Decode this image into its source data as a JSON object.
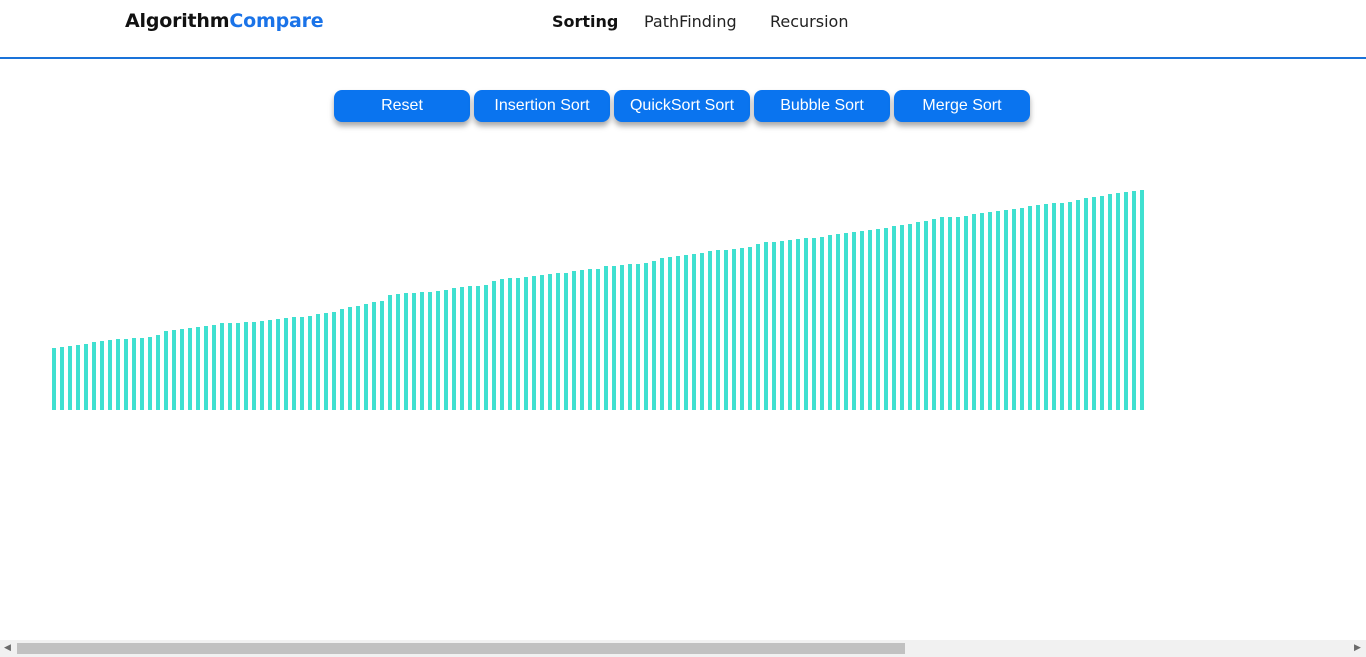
{
  "brand": {
    "part1": "Algorithm",
    "part2": "Compare"
  },
  "nav": {
    "links": [
      {
        "label": "Sorting"
      },
      {
        "label": "PathFinding"
      },
      {
        "label": "Recursion"
      }
    ]
  },
  "controls": {
    "reset": "Reset",
    "insertion": "Insertion Sort",
    "quick": "QuickSort Sort",
    "bubble": "Bubble Sort",
    "merge": "Merge Sort"
  },
  "colors": {
    "accent": "#1a73e8",
    "button": "#0a74ef",
    "bar": "#40e0d0"
  },
  "chart_data": {
    "type": "bar",
    "values": [
      59,
      60,
      61,
      62,
      63,
      65,
      66,
      67,
      68,
      68,
      69,
      69,
      70,
      72,
      75,
      76,
      77,
      78,
      79,
      80,
      81,
      83,
      83,
      83,
      84,
      84,
      85,
      86,
      87,
      88,
      89,
      89,
      90,
      92,
      93,
      94,
      96,
      98,
      99,
      101,
      103,
      104,
      110,
      111,
      112,
      112,
      113,
      113,
      114,
      115,
      116,
      117,
      118,
      118,
      119,
      123,
      125,
      126,
      126,
      127,
      128,
      129,
      130,
      131,
      131,
      133,
      134,
      135,
      135,
      137,
      137,
      138,
      139,
      139,
      140,
      142,
      145,
      146,
      147,
      148,
      149,
      150,
      152,
      153,
      153,
      154,
      155,
      156,
      158,
      160,
      160,
      161,
      162,
      163,
      164,
      164,
      165,
      167,
      168,
      169,
      170,
      171,
      172,
      173,
      174,
      176,
      177,
      178,
      179,
      180,
      182,
      184,
      184,
      184,
      185,
      187,
      188,
      189,
      190,
      191,
      192,
      193,
      195,
      196,
      197,
      198,
      198,
      199,
      200,
      202,
      203,
      204,
      206,
      207,
      208,
      209,
      210
    ],
    "ylim": [
      0,
      210
    ]
  },
  "scrollbar": {
    "position": 0.0
  }
}
